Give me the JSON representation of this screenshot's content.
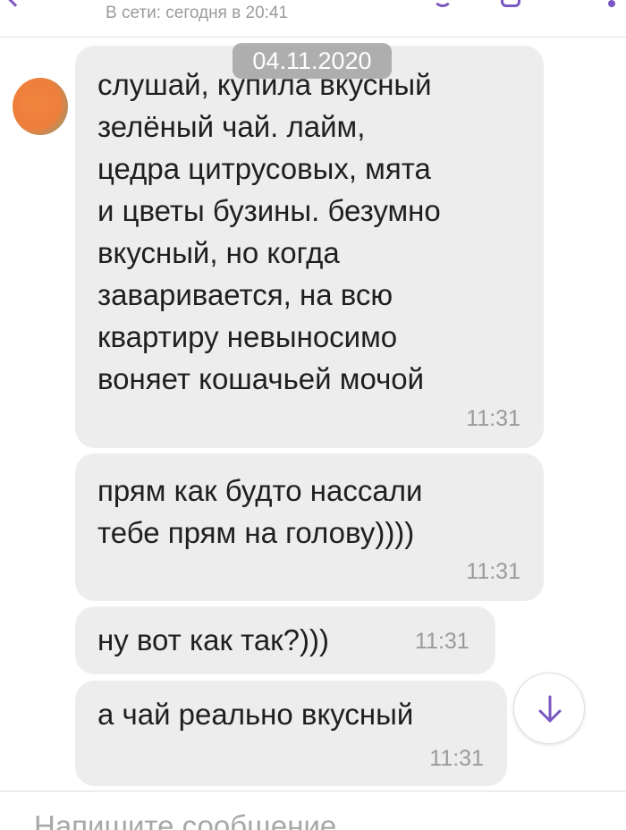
{
  "header": {
    "status": "В сети: сегодня в 20:41"
  },
  "date_chip": "04.11.2020",
  "messages": [
    {
      "text": "слушай, купила вкусный\nзелёный чай. лайм,\nцедра цитрусовых, мята\nи цветы бузины. безумно\nвкусный, но когда\nзаваривается, на всю\nквартиру невыносимо\nвоняет кошачьей мочой",
      "time": "11:31"
    },
    {
      "text": "прям как будто нассали\nтебе прям на голову))))",
      "time": "11:31"
    },
    {
      "text": "ну вот как так?)))",
      "time": "11:31"
    },
    {
      "text": "а чай реально вкусный",
      "time": "11:31"
    }
  ],
  "input": {
    "placeholder": "Напишите сообщение..."
  },
  "colors": {
    "accent": "#7a57c2",
    "bubble": "#ededed",
    "time": "#9a9a9a"
  },
  "icons": {
    "scroll_down": "arrow-down-icon",
    "avatar": "avatar"
  }
}
